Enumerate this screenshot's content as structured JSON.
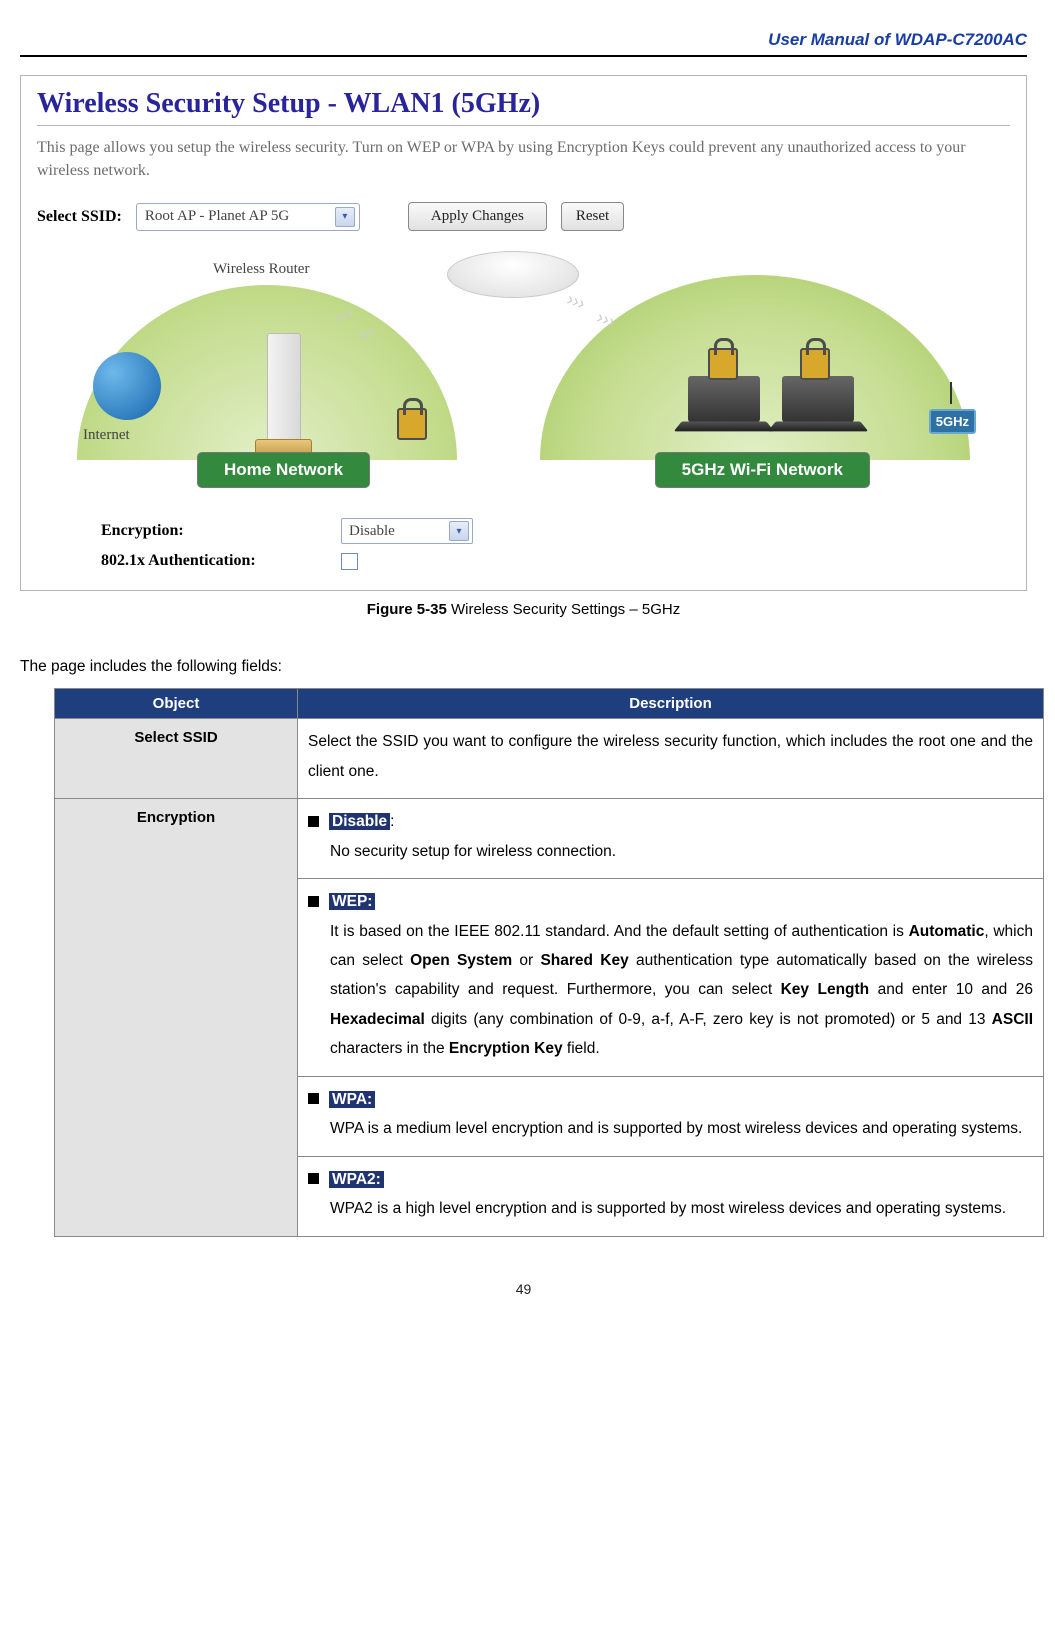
{
  "header": {
    "title": "User Manual of WDAP-C7200AC"
  },
  "screenshot": {
    "title": "Wireless Security Setup - WLAN1 (5GHz)",
    "intro": "This page allows you setup the wireless security. Turn on WEP or WPA by using Encryption Keys could prevent any unauthorized access to your wireless network.",
    "select_ssid_label": "Select SSID:",
    "select_ssid_value": "Root AP - Planet AP 5G",
    "apply_btn": "Apply Changes",
    "reset_btn": "Reset",
    "diagram": {
      "router_label": "Wireless Router",
      "internet_label": "Internet",
      "home_label": "Home Network",
      "wifi_label": "5GHz Wi-Fi Network",
      "ghz_badge": "5GHz"
    },
    "encryption_label": "Encryption:",
    "encryption_value": "Disable",
    "auth_label": "802.1x Authentication:"
  },
  "caption": {
    "fig": "Figure 5-35",
    "text": " Wireless Security Settings – 5GHz"
  },
  "lead": "The page includes the following fields:",
  "table": {
    "h_object": "Object",
    "h_desc": "Description",
    "r1_obj": "Select SSID",
    "r1_desc": "Select the SSID you want to configure the wireless security function, which includes the root one and the client one.",
    "r2_obj": "Encryption",
    "enc": {
      "disable_tag": "Disable",
      "disable_colon": ":",
      "disable_text": "No security setup for wireless connection.",
      "wep_tag": "WEP:",
      "wep_t1": "It is based on the IEEE 802.11 standard. And the default setting of authentication is ",
      "wep_b1": "Automatic",
      "wep_t2": ", which can select ",
      "wep_b2": "Open System",
      "wep_t3": " or ",
      "wep_b3": "Shared Key",
      "wep_t4": " authentication type automatically based on the wireless station's capability and request. Furthermore, you can select ",
      "wep_b4": "Key Length",
      "wep_t5": " and enter 10 and 26 ",
      "wep_b5": "Hexadecimal",
      "wep_t6": " digits (any combination of 0-9, a-f, A-F, zero key is not promoted) or 5 and 13 ",
      "wep_b6": "ASCII",
      "wep_t7": " characters in the ",
      "wep_b7": "Encryption Key",
      "wep_t8": " field.",
      "wpa_tag": "WPA:",
      "wpa_text": "WPA is a medium level encryption and is supported by most wireless devices and operating systems.",
      "wpa2_tag": "WPA2:",
      "wpa2_text": "WPA2 is a high level encryption and is supported by most wireless devices and operating systems."
    }
  },
  "page_no": "49"
}
